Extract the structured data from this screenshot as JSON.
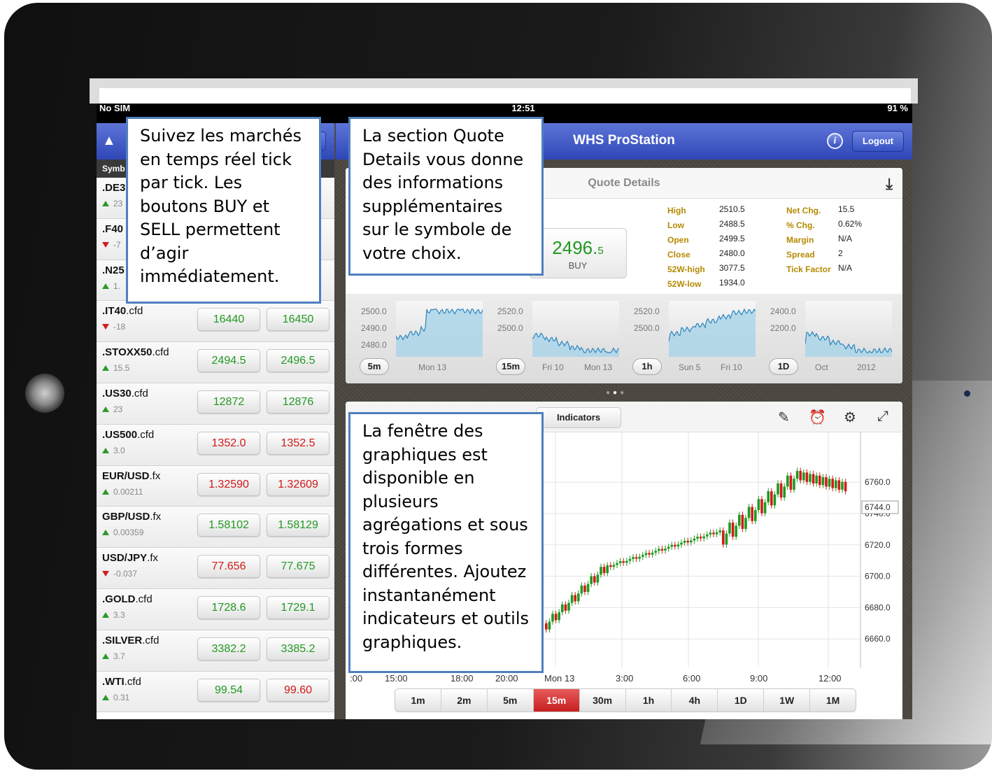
{
  "status": {
    "carrier": "No SIM",
    "time": "12:51",
    "battery": "91 %"
  },
  "app": {
    "title": "WHS ProStation",
    "logout_label": "Logout",
    "info_label": "i"
  },
  "watchlist": {
    "column_header": "Symb",
    "rows": [
      {
        "sym_bold": ".DE3",
        "sym_rest": "",
        "dir": "up",
        "change": "23",
        "sell": "",
        "buy": ""
      },
      {
        "sym_bold": ".F40",
        "sym_rest": "",
        "dir": "down",
        "change": "-7",
        "sell": "",
        "buy": ""
      },
      {
        "sym_bold": ".N25",
        "sym_rest": "",
        "dir": "up",
        "change": "1.",
        "sell": "",
        "buy": ""
      },
      {
        "sym_bold": ".IT40",
        "sym_rest": ".cfd",
        "dir": "down",
        "change": "-18",
        "sell": "16440",
        "buy": "16450",
        "sell_color": "up",
        "buy_color": "up"
      },
      {
        "sym_bold": ".STOXX50",
        "sym_rest": ".cfd",
        "dir": "up",
        "change": "15.5",
        "sell": "2494.5",
        "buy": "2496.5",
        "sell_color": "up",
        "buy_color": "up"
      },
      {
        "sym_bold": ".US30",
        "sym_rest": ".cfd",
        "dir": "up",
        "change": "23",
        "sell": "12872",
        "buy": "12876",
        "sell_color": "up",
        "buy_color": "up"
      },
      {
        "sym_bold": ".US500",
        "sym_rest": ".cfd",
        "dir": "up",
        "change": "3.0",
        "sell": "1352.0",
        "buy": "1352.5",
        "sell_color": "dn",
        "buy_color": "dn"
      },
      {
        "sym_bold": "EUR/USD",
        "sym_rest": ".fx",
        "dir": "up",
        "change": "0.00211",
        "sell": "1.32590",
        "buy": "1.32609",
        "sell_color": "dn",
        "buy_color": "dn"
      },
      {
        "sym_bold": "GBP/USD",
        "sym_rest": ".fx",
        "dir": "up",
        "change": "0.00359",
        "sell": "1.58102",
        "buy": "1.58129",
        "sell_color": "up",
        "buy_color": "up"
      },
      {
        "sym_bold": "USD/JPY",
        "sym_rest": ".fx",
        "dir": "down",
        "change": "-0.037",
        "sell": "77.656",
        "buy": "77.675",
        "sell_color": "dn",
        "buy_color": "up"
      },
      {
        "sym_bold": ".GOLD",
        "sym_rest": ".cfd",
        "dir": "up",
        "change": "3.3",
        "sell": "1728.6",
        "buy": "1729.1",
        "sell_color": "up",
        "buy_color": "up"
      },
      {
        "sym_bold": ".SILVER",
        "sym_rest": ".cfd",
        "dir": "up",
        "change": "3.7",
        "sell": "3382.2",
        "buy": "3385.2",
        "sell_color": "up",
        "buy_color": "up"
      },
      {
        "sym_bold": ".WTI",
        "sym_rest": ".cfd",
        "dir": "up",
        "change": "0.31",
        "sell": "99.54",
        "buy": "99.60",
        "sell_color": "up",
        "buy_color": "dn"
      }
    ]
  },
  "quote": {
    "title": "Quote Details",
    "buy_price_main": "2496.",
    "buy_price_small": "5",
    "buy_label": "BUY",
    "stats_left": [
      {
        "label": "High",
        "value": "2510.5"
      },
      {
        "label": "Low",
        "value": "2488.5"
      },
      {
        "label": "Open",
        "value": "2499.5"
      },
      {
        "label": "Close",
        "value": "2480.0"
      },
      {
        "label": "52W-high",
        "value": "3077.5"
      },
      {
        "label": "52W-low",
        "value": "1934.0"
      }
    ],
    "stats_right": [
      {
        "label": "Net Chg.",
        "value": "15.5"
      },
      {
        "label": "% Chg.",
        "value": "0.62%"
      },
      {
        "label": "Margin",
        "value": "N/A"
      },
      {
        "label": "Spread",
        "value": "2"
      },
      {
        "label": "Tick Factor",
        "value": "N/A"
      }
    ],
    "minis": [
      {
        "tf": "5m",
        "ticks": [
          "2500.0",
          "2490.0",
          "2480.0"
        ],
        "x": [
          "Mon 13"
        ]
      },
      {
        "tf": "15m",
        "ticks": [
          "2520.0",
          "2500.0"
        ],
        "x": [
          "Fri 10",
          "Mon 13"
        ]
      },
      {
        "tf": "1h",
        "ticks": [
          "2520.0",
          "2500.0"
        ],
        "x": [
          "Sun 5",
          "Fri 10"
        ]
      },
      {
        "tf": "1D",
        "ticks": [
          "2400.0",
          "2200.0"
        ],
        "x": [
          "Oct",
          "2012"
        ]
      }
    ]
  },
  "chart": {
    "indicators_label": "Indicators",
    "y_ticks": [
      "6760.0",
      "6740.0",
      "6720.0",
      "6700.0",
      "6680.0",
      "6660.0"
    ],
    "last_price": "6744.0",
    "x_ticks": [
      ":00",
      "15:00",
      "18:00",
      "20:00",
      "Mon 13",
      "3:00",
      "6:00",
      "9:00",
      "12:00"
    ],
    "timeframes": [
      "1m",
      "2m",
      "5m",
      "15m",
      "30m",
      "1h",
      "4h",
      "1D",
      "1W",
      "1M"
    ],
    "selected_timeframe": "15m",
    "colors": {
      "bull": "#1e9a1e",
      "bear": "#d41a1a"
    }
  },
  "callouts": {
    "watchlist": "Suivez les marchés en temps réel tick par tick. Les boutons BUY et SELL permettent d’agir immédiatement.",
    "quote": "La section Quote Details vous donne des informations supplémentaires sur le symbole de votre choix.",
    "chart": "La fenêtre des graphiques est disponible en plusieurs agrégations et sous trois formes différentes. Ajoutez instantanément indicateurs et outils graphiques."
  }
}
